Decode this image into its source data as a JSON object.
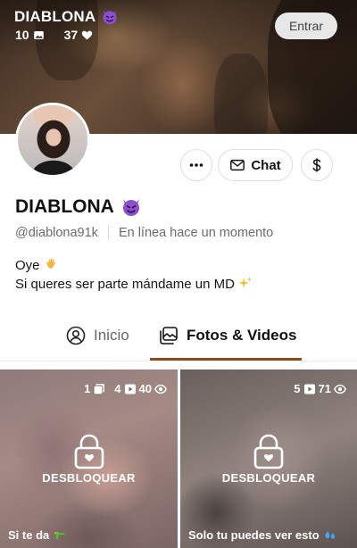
{
  "banner": {
    "name": "DIABLONA",
    "photos_count": "10",
    "likes_count": "37",
    "login_label": "Entrar"
  },
  "profile": {
    "name": "DIABLONA",
    "username": "@diablona91k",
    "status": "En línea hace un momento",
    "bio_line1": "Oye",
    "bio_line2": "Si queres ser parte mándame un MD"
  },
  "actions": {
    "chat_label": "Chat"
  },
  "tabs": [
    {
      "label": "Inicio",
      "active": false
    },
    {
      "label": "Fotos & Videos",
      "active": true
    }
  ],
  "posts": [
    {
      "photos": "1",
      "images": "4",
      "videos": "40",
      "unlock_label": "DESBLOQUEAR",
      "caption": "Si te da"
    },
    {
      "videos": "5",
      "views": "71",
      "unlock_label": "DESBLOQUEAR",
      "caption": "Solo tu puedes ver esto"
    }
  ],
  "colors": {
    "accent": "#8a4a1e",
    "devil": "#7b3fbf",
    "login_bg": "#e7e7e7"
  },
  "icons": [
    "image-icon",
    "heart-icon",
    "more-icon",
    "mail-icon",
    "dollar-icon",
    "user-circle-icon",
    "gallery-icon",
    "photo-icon",
    "stack-icon",
    "video-icon",
    "eye-icon",
    "lock-icon",
    "wave-emoji-icon",
    "sparkles-emoji-icon",
    "water-gun-emoji-icon",
    "droplets-emoji-icon",
    "devil-emoji-icon"
  ]
}
